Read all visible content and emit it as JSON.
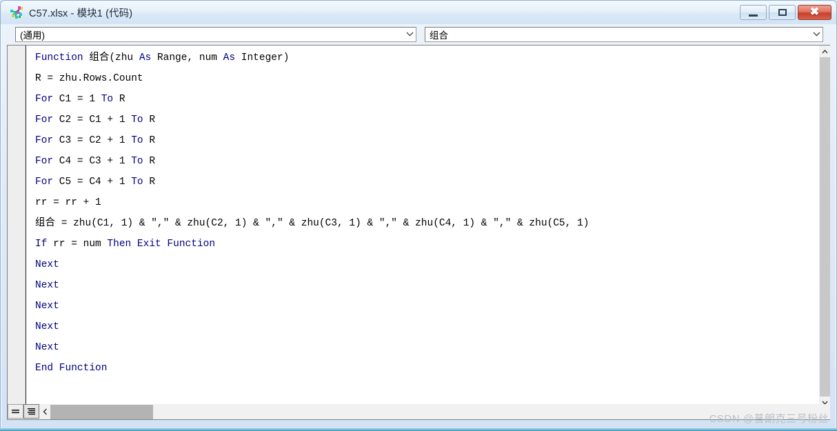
{
  "window": {
    "title": "C57.xlsx - 模块1 (代码)",
    "icon": "vba-module-icon",
    "buttons": {
      "minimize": {
        "name": "minimize-button",
        "glyph": "—"
      },
      "maximize": {
        "name": "maximize-button",
        "glyph": "❐"
      },
      "close": {
        "name": "close-button",
        "glyph": "✕"
      }
    }
  },
  "toolbar": {
    "object_combo": {
      "label": "object-dropdown",
      "value": "(通用)"
    },
    "procedure_combo": {
      "label": "procedure-dropdown",
      "value": "组合"
    }
  },
  "code": {
    "lines": [
      [
        {
          "t": "Function",
          "c": "kw"
        },
        {
          "t": " 组合(zhu ",
          "c": "pl"
        },
        {
          "t": "As",
          "c": "kw"
        },
        {
          "t": " Range, num ",
          "c": "pl"
        },
        {
          "t": "As",
          "c": "kw"
        },
        {
          "t": " Integer)",
          "c": "pl"
        }
      ],
      [
        {
          "t": "R = zhu.Rows.Count",
          "c": "pl"
        }
      ],
      [
        {
          "t": "For",
          "c": "kw"
        },
        {
          "t": " C1 = 1 ",
          "c": "pl"
        },
        {
          "t": "To",
          "c": "kw"
        },
        {
          "t": " R",
          "c": "pl"
        }
      ],
      [
        {
          "t": "For",
          "c": "kw"
        },
        {
          "t": " C2 = C1 + 1 ",
          "c": "pl"
        },
        {
          "t": "To",
          "c": "kw"
        },
        {
          "t": " R",
          "c": "pl"
        }
      ],
      [
        {
          "t": "For",
          "c": "kw"
        },
        {
          "t": " C3 = C2 + 1 ",
          "c": "pl"
        },
        {
          "t": "To",
          "c": "kw"
        },
        {
          "t": " R",
          "c": "pl"
        }
      ],
      [
        {
          "t": "For",
          "c": "kw"
        },
        {
          "t": " C4 = C3 + 1 ",
          "c": "pl"
        },
        {
          "t": "To",
          "c": "kw"
        },
        {
          "t": " R",
          "c": "pl"
        }
      ],
      [
        {
          "t": "For",
          "c": "kw"
        },
        {
          "t": " C5 = C4 + 1 ",
          "c": "pl"
        },
        {
          "t": "To",
          "c": "kw"
        },
        {
          "t": " R",
          "c": "pl"
        }
      ],
      [
        {
          "t": "rr = rr + 1",
          "c": "pl"
        }
      ],
      [
        {
          "t": "组合 = zhu(C1, 1) & \",\" & zhu(C2, 1) & \",\" & zhu(C3, 1) & \",\" & zhu(C4, 1) & \",\" & zhu(C5, 1)",
          "c": "pl"
        }
      ],
      [
        {
          "t": "If",
          "c": "kw"
        },
        {
          "t": " rr = num ",
          "c": "pl"
        },
        {
          "t": "Then Exit Function",
          "c": "kw"
        }
      ],
      [
        {
          "t": "Next",
          "c": "kw"
        }
      ],
      [
        {
          "t": "Next",
          "c": "kw"
        }
      ],
      [
        {
          "t": "Next",
          "c": "kw"
        }
      ],
      [
        {
          "t": "Next",
          "c": "kw"
        }
      ],
      [
        {
          "t": "Next",
          "c": "kw"
        }
      ],
      [
        {
          "t": "End Function",
          "c": "kw"
        }
      ]
    ]
  },
  "statusbar": {
    "procedure_view_button": "procedure-view-button",
    "full_module_view_button": "full-module-view-button"
  },
  "watermark": {
    "text": "CSDN @普朗克三号粉丝"
  },
  "colors": {
    "keyword": "#00007F",
    "plain": "#000000",
    "title_bar": "#E3EDF8",
    "close_button": "#C5402C",
    "code_background": "#FFFFFF"
  }
}
